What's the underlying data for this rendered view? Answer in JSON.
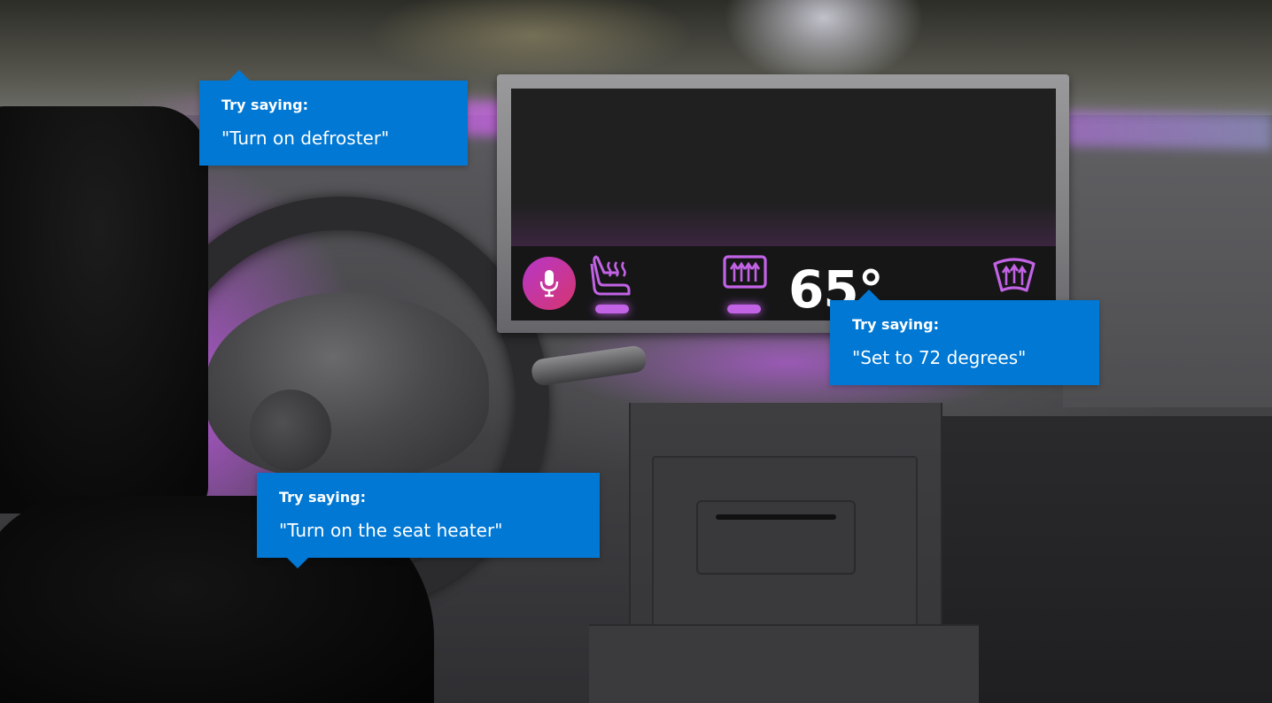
{
  "display": {
    "temperature": "65°",
    "controls": {
      "mic_icon": "microphone-icon",
      "seat_heater_icon": "seat-heater-icon",
      "rear_defrost_icon": "rear-defroster-icon",
      "front_defrost_icon": "front-defroster-icon"
    },
    "colors": {
      "accent": "#c263e6",
      "mic_gradient_start": "#b737c9",
      "mic_gradient_end": "#d5356e"
    }
  },
  "callouts": {
    "defroster": {
      "header": "Try saying:",
      "phrase": "\"Turn on defroster\""
    },
    "temperature": {
      "header": "Try saying:",
      "phrase": "\"Set to 72 degrees\""
    },
    "seat_heater": {
      "header": "Try saying:",
      "phrase": "\"Turn on the seat heater\""
    }
  },
  "colors": {
    "callout_blue": "#0078d4"
  }
}
